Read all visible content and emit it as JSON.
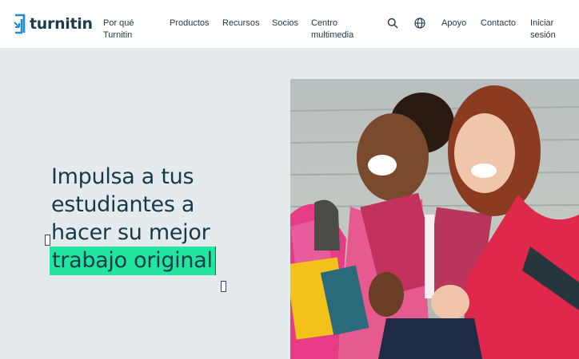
{
  "brand": {
    "name": "turnitin"
  },
  "nav": {
    "items": [
      {
        "id": "why",
        "label_line1": "Por qué",
        "label_line2": "Turnitin"
      },
      {
        "id": "products",
        "label": "Productos"
      },
      {
        "id": "resources",
        "label": "Recursos"
      },
      {
        "id": "partners",
        "label": "Socios"
      },
      {
        "id": "media",
        "label_line1": "Centro",
        "label_line2": "multimedia"
      }
    ],
    "search_icon": "search-icon",
    "language_icon": "globe-icon",
    "support": "Apoyo",
    "contact": "Contacto",
    "login_line1": "Iniciar",
    "login_line2": "sesión"
  },
  "hero": {
    "headline_lines": [
      "Impulsa a tus",
      "estudiantes a",
      "hacer su mejor"
    ],
    "headline_highlight": "trabajo original",
    "highlight_color": "#22e6a0",
    "image_icon": "students-laughing-with-books-photo"
  },
  "colors": {
    "background": "#e5ebec",
    "text": "#163a4a",
    "brand_blue": "#1f8ad6"
  }
}
